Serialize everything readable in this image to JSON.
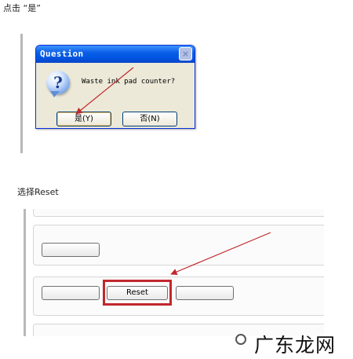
{
  "captions": {
    "step1": "点击 “是”",
    "step2": "选择Reset"
  },
  "dialog": {
    "title": "Question",
    "close_symbol": "×",
    "icon": "question-icon",
    "icon_symbol": "?",
    "message": "Waste ink pad counter?",
    "yes_label": "是(Y)",
    "no_label": "否(N)"
  },
  "form": {
    "reset_label": "Reset"
  },
  "annotation": {
    "arrow_color": "#c0282d",
    "highlight_color": "#c0282d"
  },
  "watermark": {
    "text": "广东龙网"
  }
}
